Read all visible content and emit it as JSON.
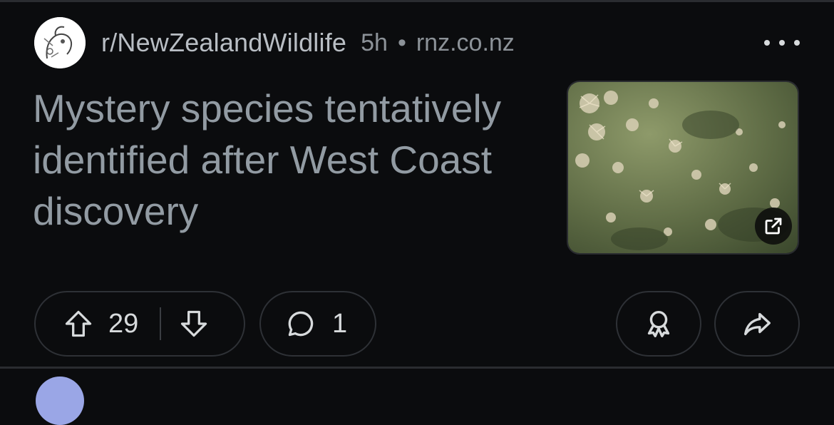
{
  "post": {
    "subreddit": "r/NewZealandWildlife",
    "age": "5h",
    "separator": "•",
    "domain": "rnz.co.nz",
    "title": "Mystery species tentatively identified after West Coast discovery",
    "thumbnail_alt": "Seabed covered with tube-dwelling sea creatures"
  },
  "actions": {
    "upvotes": "29",
    "comments": "1"
  },
  "colors": {
    "background": "#0b0c0e",
    "title": "#929ba3",
    "subreddit": "#b9bec4",
    "meta": "#8c9298",
    "pill_border": "#2e3136",
    "icon": "#d7dadc"
  },
  "icons": {
    "avatar": "subreddit-avatar",
    "more": "more-horizontal-icon",
    "external": "external-link-icon",
    "upvote": "upvote-arrow-icon",
    "downvote": "downvote-arrow-icon",
    "comment": "comment-bubble-icon",
    "award": "award-icon",
    "share": "share-arrow-icon"
  }
}
